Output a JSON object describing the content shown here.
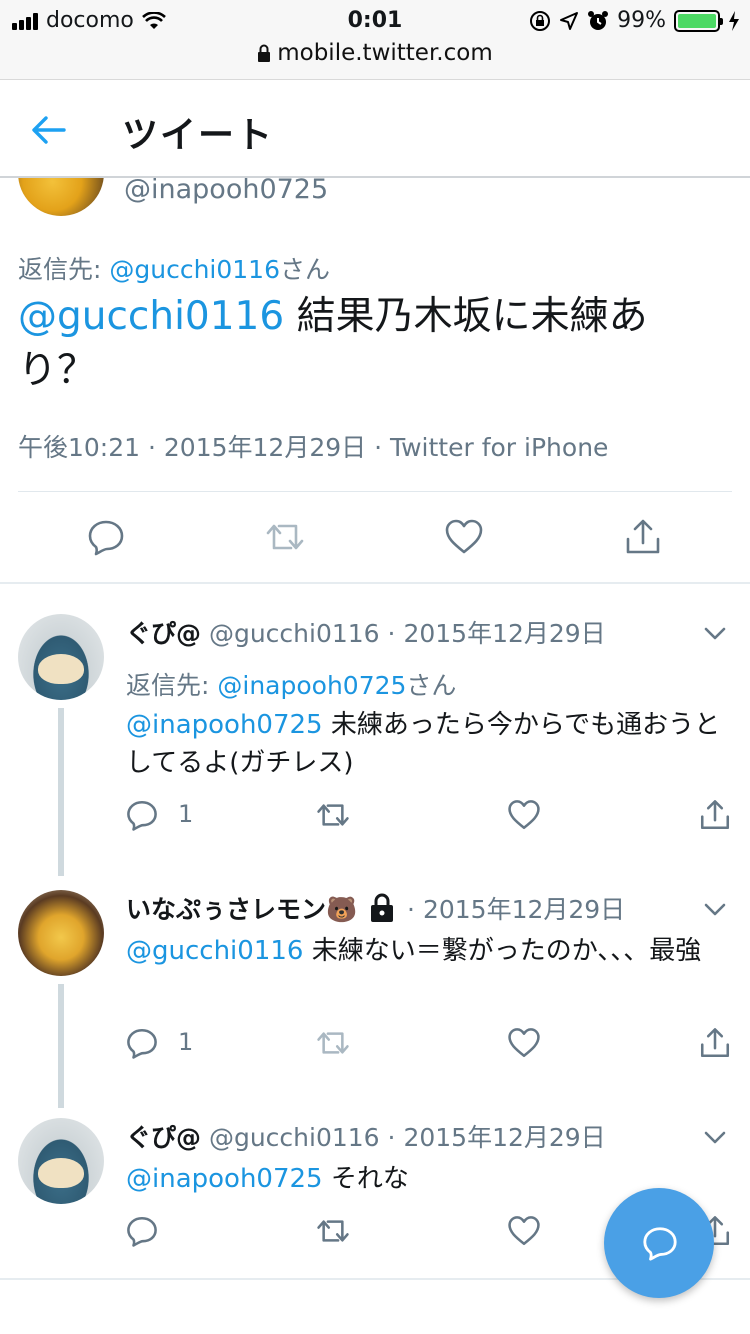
{
  "status_bar": {
    "carrier": "docomo",
    "time": "0:01",
    "battery": "99%",
    "url": "mobile.twitter.com"
  },
  "header": {
    "title": "ツイート"
  },
  "main_tweet": {
    "handle": "@inapooh0725",
    "reply_to_prefix": "返信先: ",
    "reply_to_user": "@gucchi0116",
    "reply_to_suffix": "さん",
    "mention": "@gucchi0116",
    "text": " 結果乃木坂に未練あり？",
    "meta": "午後10:21 · 2015年12月29日 · Twitter for iPhone"
  },
  "replies": [
    {
      "name": "ぐぴ@",
      "handle": "@gucchi0116",
      "date": "· 2015年12月29日",
      "reply_to_prefix": "返信先: ",
      "reply_to_user": "@inapooh0725",
      "reply_to_suffix": "さん",
      "mention": "@inapooh0725",
      "text": " 未練あったら今からでも通おうとしてるよ(ガチレス)",
      "reply_count": "1"
    },
    {
      "name": "いなぷぅさレモン🐻",
      "date": "· 2015年12月29日",
      "mention": "@gucchi0116",
      "text": " 未練ない＝繋がったのか、、、最強",
      "reply_count": "1"
    },
    {
      "name": "ぐぴ@",
      "handle": "@gucchi0116",
      "date": "· 2015年12月29日",
      "mention": "@inapooh0725",
      "text": " それな"
    }
  ],
  "colors": {
    "accent": "#1b95e0",
    "grey": "#657786",
    "fab": "#4aa0e6"
  }
}
